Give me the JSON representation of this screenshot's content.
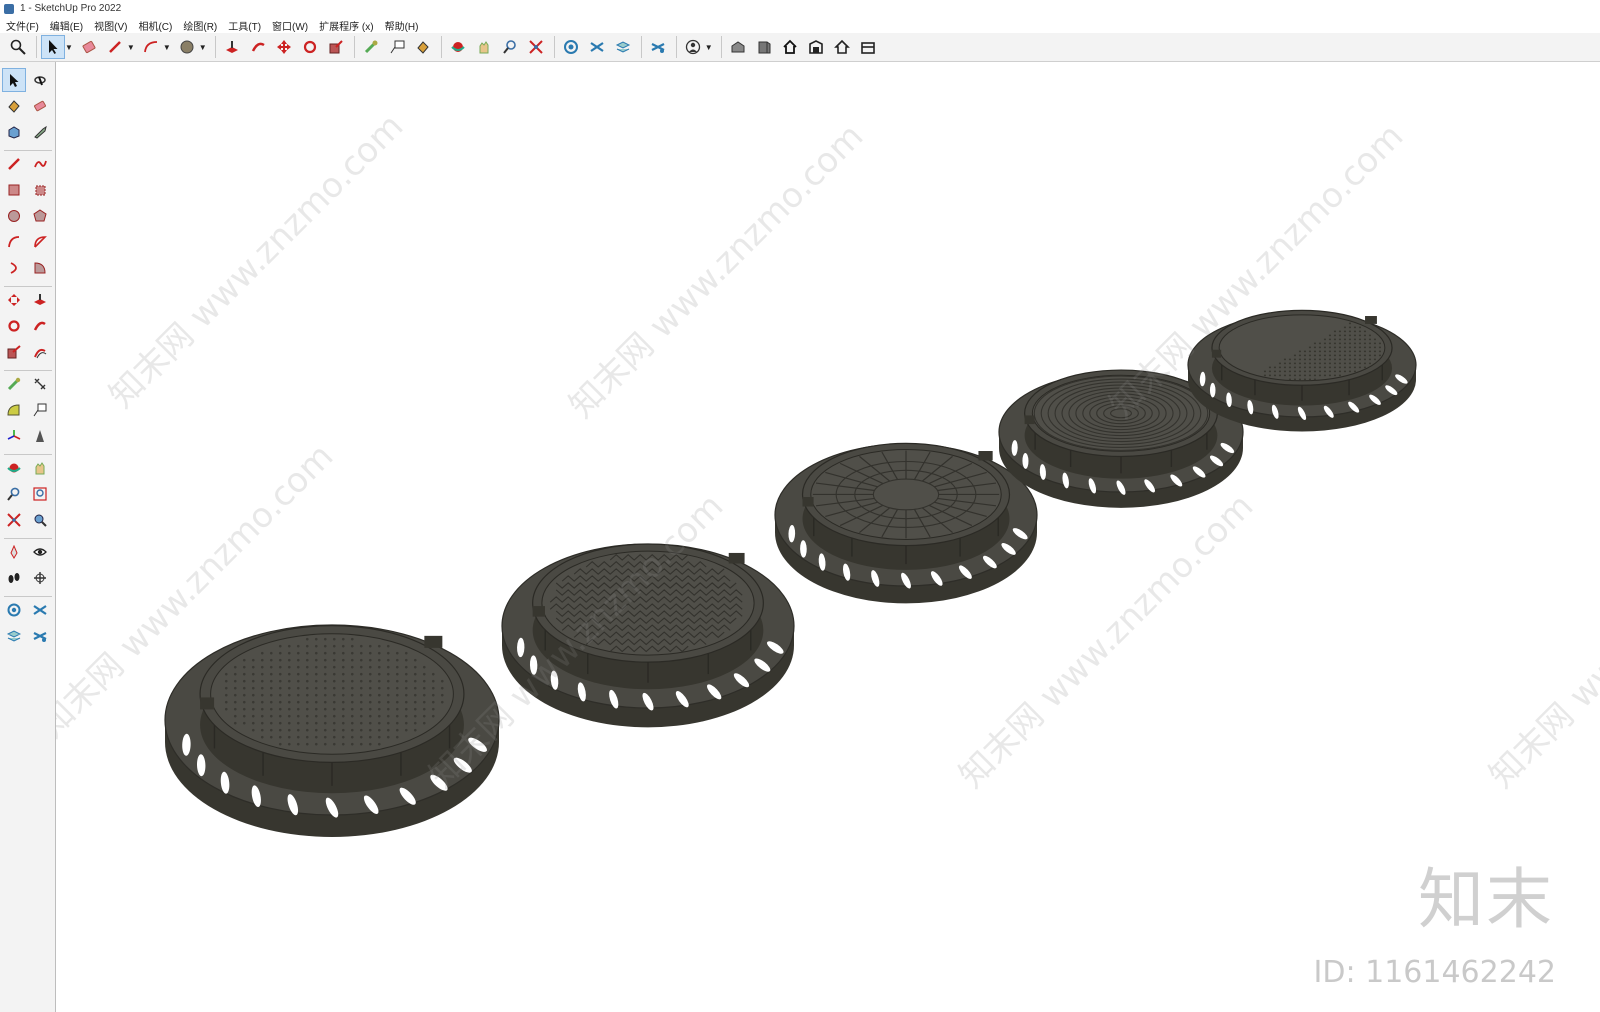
{
  "window": {
    "title": "1 - SketchUp Pro 2022"
  },
  "menu": [
    "文件(F)",
    "编辑(E)",
    "视图(V)",
    "相机(C)",
    "绘图(R)",
    "工具(T)",
    "窗口(W)",
    "扩展程序 (x)",
    "帮助(H)"
  ],
  "toolbar_icons": [
    "zoom-icon",
    "select-icon",
    "eraser-icon",
    "pencil-icon",
    "arc-icon",
    "paint-icon",
    "push-pull-icon",
    "follow-me-icon",
    "move-icon",
    "rotate-icon",
    "scale-icon",
    "tape-icon",
    "text-icon",
    "paint-bucket-icon",
    "orbit-icon",
    "pan-icon",
    "zoom-tool-icon",
    "zoom-extents-icon",
    "warehouse-icon",
    "extension-icon",
    "layers-icon",
    "sandbox-icon",
    "profile-icon",
    "iso-view-icon",
    "front-view-icon",
    "home-icon",
    "back-view-icon",
    "house-icon",
    "side-view-icon"
  ],
  "viewport": {
    "watermark_text": "知末网 www.znzmo.com",
    "brand_mark": "知末",
    "id_label": "ID: 1161462242",
    "models": [
      "manhole-cover-dotted",
      "manhole-cover-wave",
      "manhole-cover-radial",
      "manhole-cover-concentric",
      "manhole-cover-textured"
    ]
  },
  "colors": {
    "model": "#4a4943",
    "model_dark": "#37362f",
    "selection": "#cde3f7",
    "accent": "#3b6ea5"
  }
}
